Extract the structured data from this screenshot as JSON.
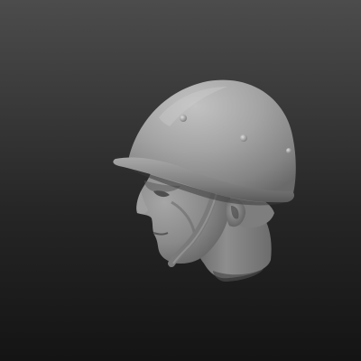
{
  "scene": {
    "subject": "sculpted-head-with-helmet",
    "material": "matte-gray-clay",
    "colors": {
      "background_top": "#4c4c4c",
      "background_bottom": "#141414",
      "clay_light": "#b4b4b4",
      "clay_mid": "#8c8c8c",
      "clay_dark": "#4a4a4a"
    }
  }
}
